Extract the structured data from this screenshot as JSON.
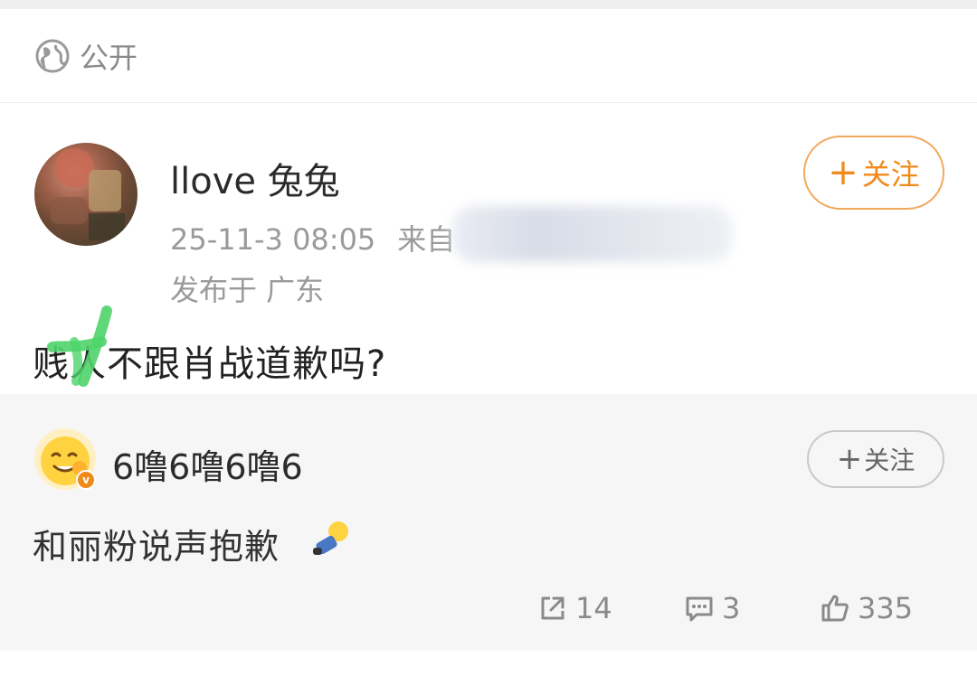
{
  "visibility": {
    "label": "公开",
    "icon": "globe-icon"
  },
  "post": {
    "username": "llove 兔兔",
    "time": "25-11-3 08:05",
    "source_prefix": "来自",
    "region": "发布于 广东",
    "follow_label": "关注",
    "follow_plus": "+",
    "text": "贱人不跟肖战道歉吗?"
  },
  "repost": {
    "username": "6噜6噜6噜6",
    "badge": "v",
    "follow_label": "关注",
    "follow_plus": "+",
    "text": "和丽粉说声抱歉"
  },
  "actions": {
    "share_count": "14",
    "comment_count": "3",
    "like_count": "335"
  },
  "colors": {
    "accent": "#f08a1a",
    "muted": "#9a9a9a",
    "card_bg": "#f6f6f6"
  }
}
